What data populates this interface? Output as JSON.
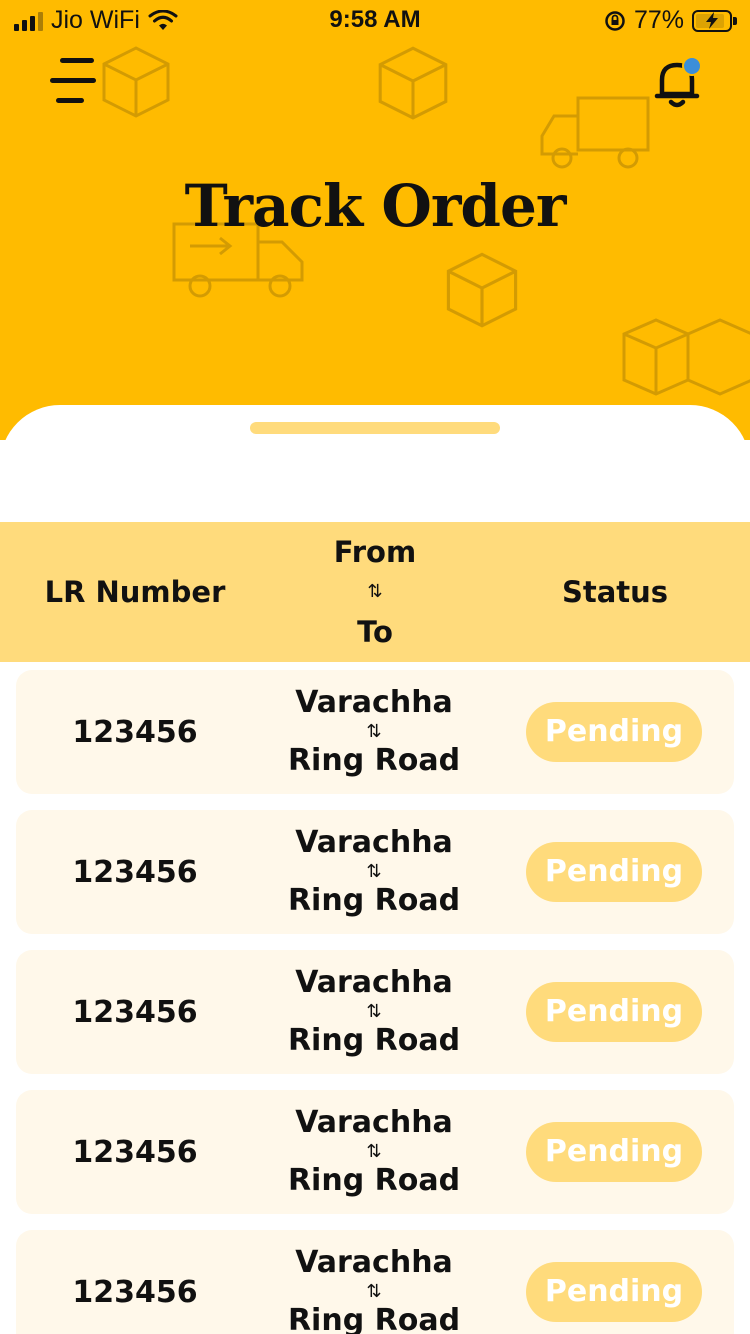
{
  "status_bar": {
    "carrier": "Jio WiFi",
    "time": "9:58 AM",
    "battery": "77%"
  },
  "header": {
    "title": "Track Order"
  },
  "table": {
    "columns": {
      "lr_number": "LR Number",
      "from": "From",
      "to": "To",
      "status": "Status"
    },
    "swap_glyph": "⇅",
    "rows": [
      {
        "lr": "123456",
        "from": "Varachha",
        "to": "Ring Road",
        "status": "Pending"
      },
      {
        "lr": "123456",
        "from": "Varachha",
        "to": "Ring Road",
        "status": "Pending"
      },
      {
        "lr": "123456",
        "from": "Varachha",
        "to": "Ring Road",
        "status": "Pending"
      },
      {
        "lr": "123456",
        "from": "Varachha",
        "to": "Ring Road",
        "status": "Pending"
      },
      {
        "lr": "123456",
        "from": "Varachha",
        "to": "Ring Road",
        "status": "Pending"
      }
    ]
  },
  "colors": {
    "brand_yellow": "#FFBB00",
    "light_yellow": "#FFDB7C",
    "row_bg": "#FFF8EA",
    "notification_dot": "#3B8ED9"
  },
  "icons": {
    "menu": "menu-icon",
    "notifications": "bell-icon"
  }
}
